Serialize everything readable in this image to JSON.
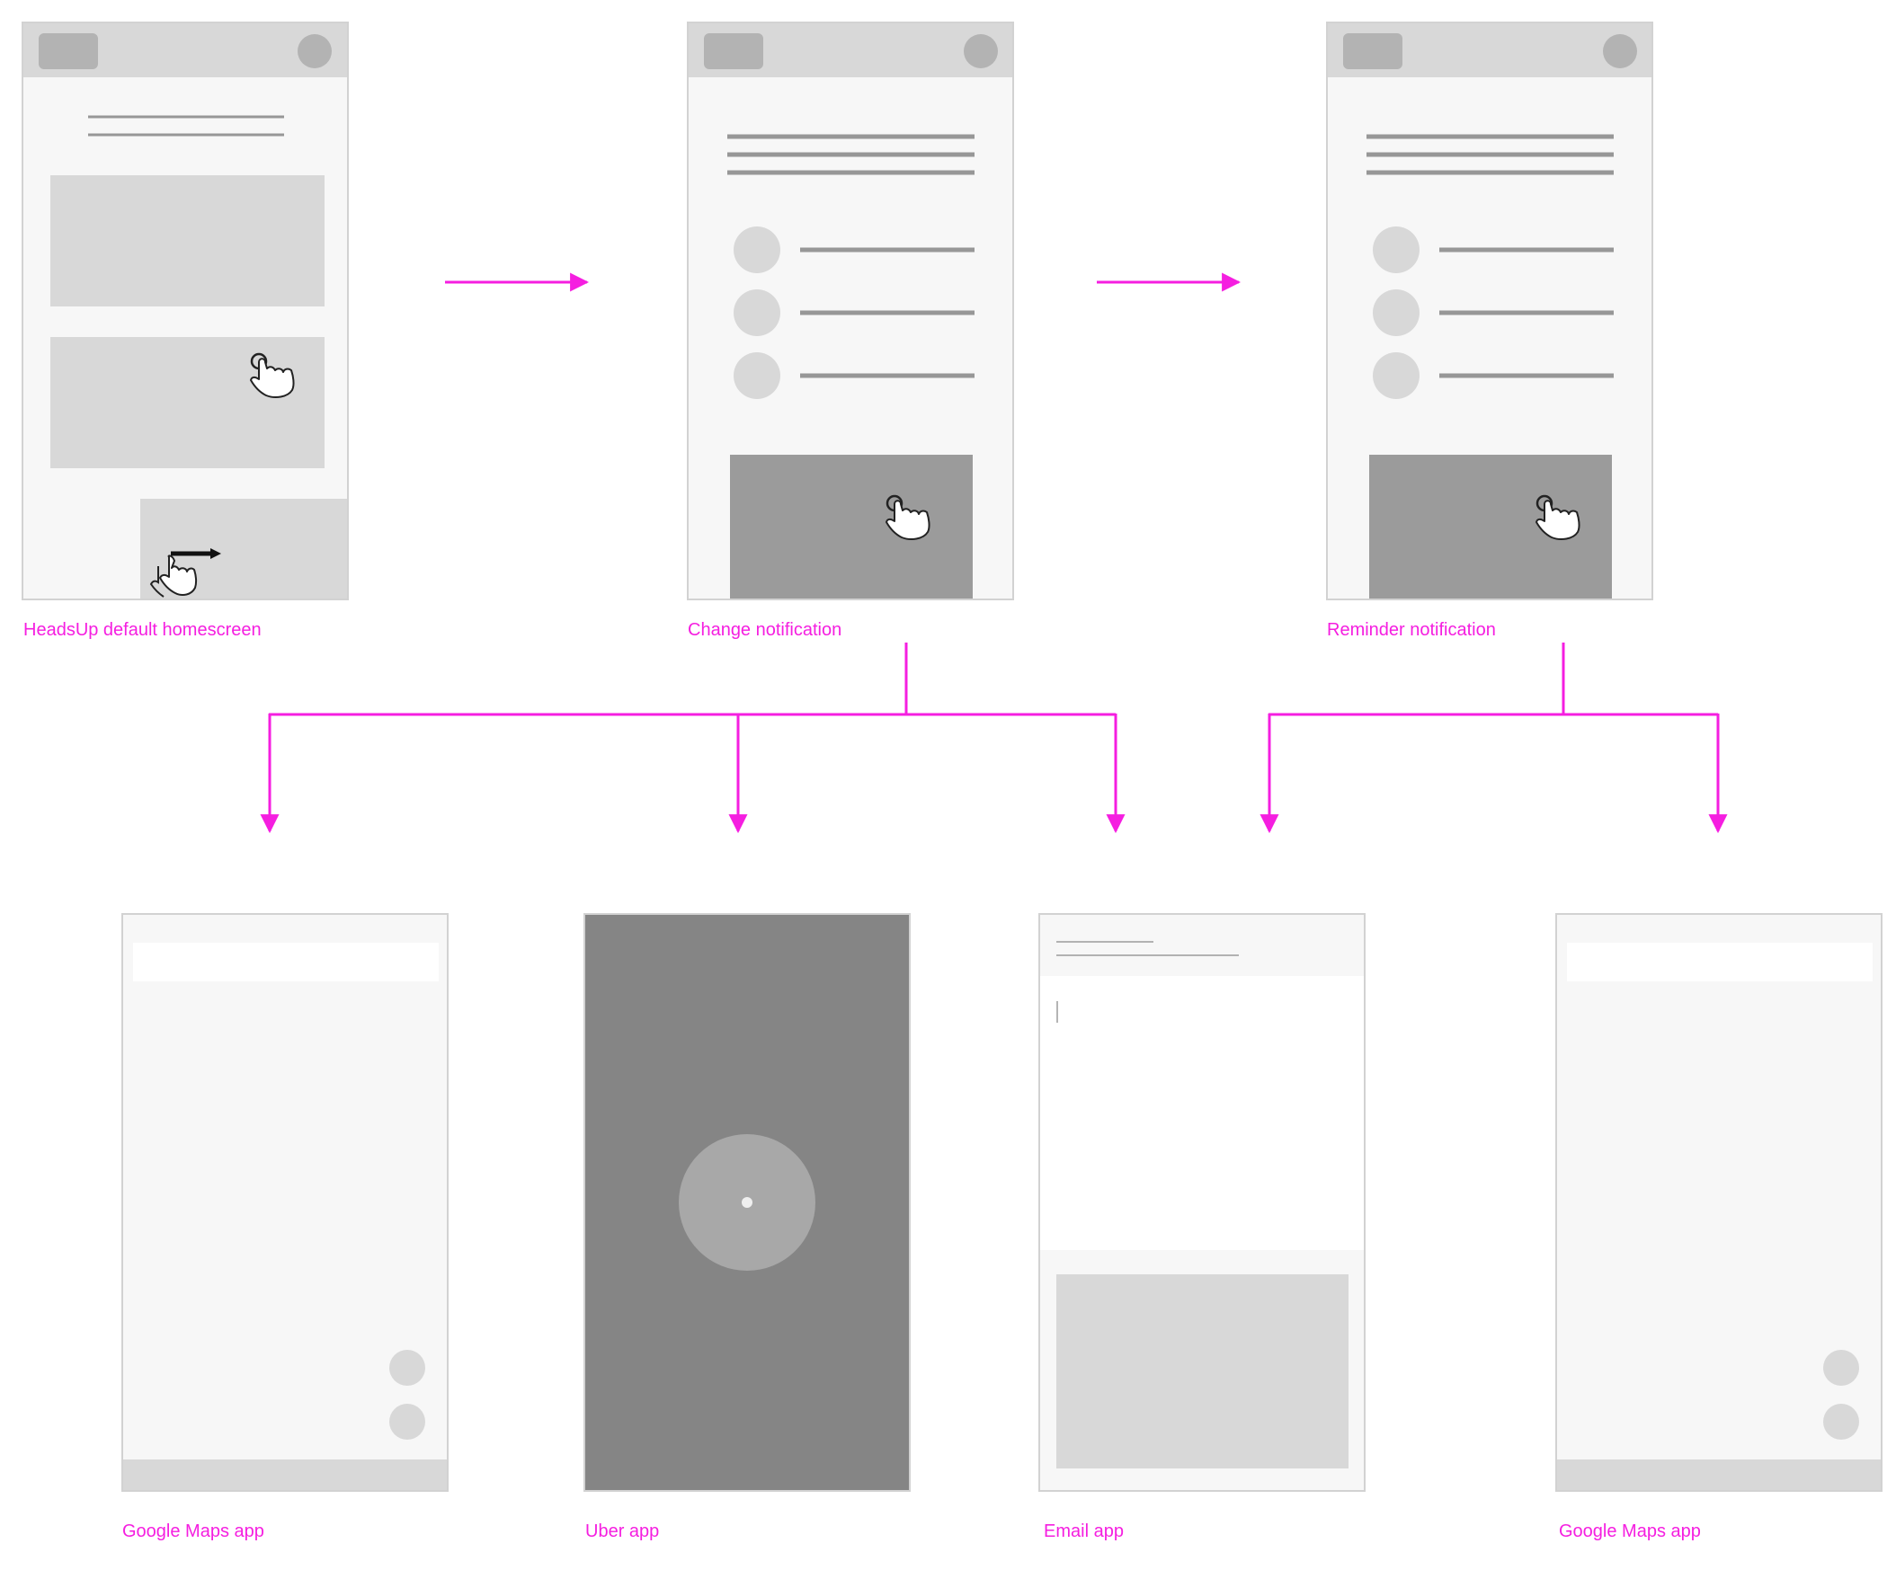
{
  "colors": {
    "flow": "#f51ee0",
    "frame_bg": "#f7f7f7",
    "frame_border": "#d2d2d2",
    "block": "#d8d8d8",
    "block_dark": "#9b9b9b",
    "header_button": "#b3b3b3",
    "text_line": "#979797",
    "uber_bg": "#858585",
    "uber_circle": "#a8a8a8"
  },
  "screens": {
    "homescreen": {
      "label": "HeadsUp default homescreen"
    },
    "change": {
      "label": "Change notification"
    },
    "reminder": {
      "label": "Reminder notification"
    },
    "maps1": {
      "label": "Google Maps app"
    },
    "uber": {
      "label": "Uber app"
    },
    "email": {
      "label": "Email app"
    },
    "maps2": {
      "label": "Google Maps app"
    }
  },
  "icons": {
    "tap": "hand-tap-icon",
    "swipe": "hand-swipe-icon"
  }
}
